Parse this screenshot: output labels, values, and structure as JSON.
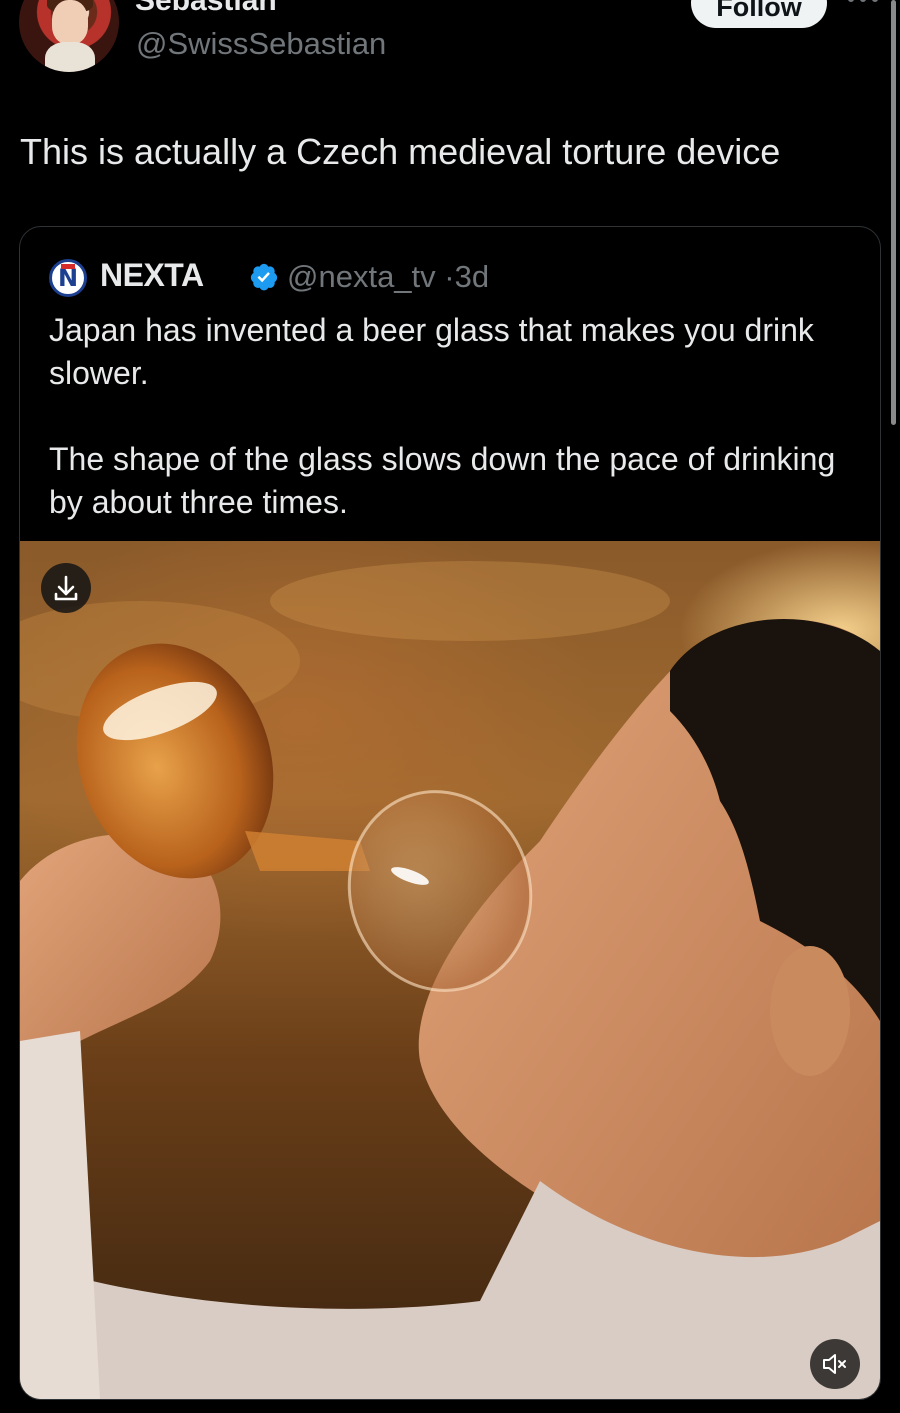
{
  "tweet": {
    "author_name": "Sebastian",
    "author_handle": "@SwissSebastian",
    "follow_label": "Follow",
    "text": "This is actually a Czech medieval  torture device"
  },
  "quote": {
    "author_name": "NEXTA",
    "author_handle": "@nexta_tv",
    "time_ago": "3d",
    "paragraphs": [
      "Japan has invented a beer glass that makes you drink slower.",
      "The shape of the glass slows down the pace of drinking by about three times."
    ],
    "media": {
      "type": "video",
      "muted": true
    }
  },
  "icons": {
    "more": "more-icon",
    "verified": "verified-badge-icon",
    "download": "download-icon",
    "mute": "mute-icon"
  },
  "colors": {
    "background": "#000000",
    "text": "#e7e9ea",
    "secondary_text": "#71767b",
    "verified": "#1d9bf0",
    "follow_button_bg": "#eff3f4"
  }
}
